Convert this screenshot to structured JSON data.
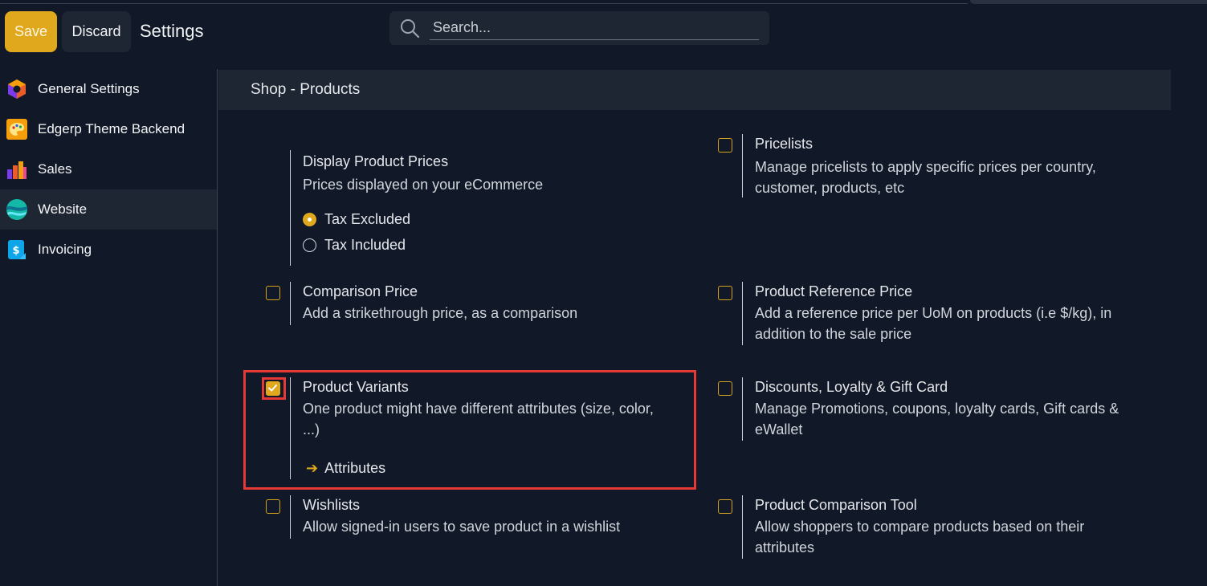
{
  "header": {
    "save_label": "Save",
    "discard_label": "Discard",
    "title": "Settings"
  },
  "search": {
    "placeholder": "Search..."
  },
  "colors": {
    "accent": "#e0a81d",
    "background": "#111827",
    "panel": "#1f2633",
    "highlight": "#e53935"
  },
  "sidebar": {
    "items": [
      {
        "label": "General Settings",
        "icon": "general-settings-icon"
      },
      {
        "label": "Edgerp Theme Backend",
        "icon": "palette-icon"
      },
      {
        "label": "Sales",
        "icon": "sales-chart-icon"
      },
      {
        "label": "Website",
        "icon": "website-icon",
        "active": true
      },
      {
        "label": "Invoicing",
        "icon": "invoicing-icon"
      }
    ]
  },
  "section": {
    "title": "Shop - Products"
  },
  "settings": {
    "display_prices": {
      "title": "Display Product Prices",
      "desc": "Prices displayed on your eCommerce",
      "options": [
        "Tax Excluded",
        "Tax Included"
      ],
      "selected": "Tax Excluded"
    },
    "pricelists": {
      "title": "Pricelists",
      "desc_line1": "Manage pricelists to apply specific prices per country,",
      "desc_line2": "customer, products, etc",
      "checked": false
    },
    "comparison_price": {
      "title": "Comparison Price",
      "desc": "Add a strikethrough price, as a comparison",
      "checked": false
    },
    "reference_price": {
      "title": "Product Reference Price",
      "desc_line1": "Add a reference price per UoM on products (i.e $/kg), in",
      "desc_line2": "addition to the sale price",
      "checked": false
    },
    "variants": {
      "title": "Product Variants",
      "desc_line1": "One product might have different attributes (size, color,",
      "desc_line2": "...)",
      "link": "Attributes",
      "checked": true
    },
    "discounts": {
      "title": "Discounts, Loyalty & Gift Card",
      "desc_line1": "Manage Promotions, coupons, loyalty cards, Gift cards &",
      "desc_line2": "eWallet",
      "checked": false
    },
    "wishlists": {
      "title": "Wishlists",
      "desc": "Allow signed-in users to save product in a wishlist",
      "checked": false
    },
    "comparison_tool": {
      "title": "Product Comparison Tool",
      "desc_line1": "Allow shoppers to compare products based on their",
      "desc_line2": "attributes",
      "checked": false
    }
  }
}
